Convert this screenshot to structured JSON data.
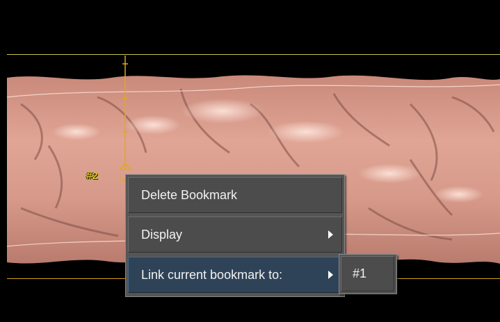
{
  "bookmark": {
    "label": "#2"
  },
  "context_menu": {
    "items": [
      {
        "label": "Delete Bookmark",
        "has_submenu": false
      },
      {
        "label": "Display",
        "has_submenu": true
      },
      {
        "label": "Link current bookmark to:",
        "has_submenu": true,
        "highlighted": true
      }
    ]
  },
  "submenu": {
    "items": [
      {
        "label": "#1"
      }
    ]
  },
  "colors": {
    "background": "#000000",
    "tissue": "#d99a8a",
    "boundary_top": "#c9c24a",
    "boundary_bottom": "#d8a21a",
    "marker": "#e0a81e",
    "menu_bg": "#555555",
    "menu_highlight": "#2f4358",
    "bookmark_label": "#d9c327"
  },
  "icons": {
    "submenu_arrow": "triangle-right-icon",
    "bookmark_marker": "bookmark-anchor-icon"
  }
}
